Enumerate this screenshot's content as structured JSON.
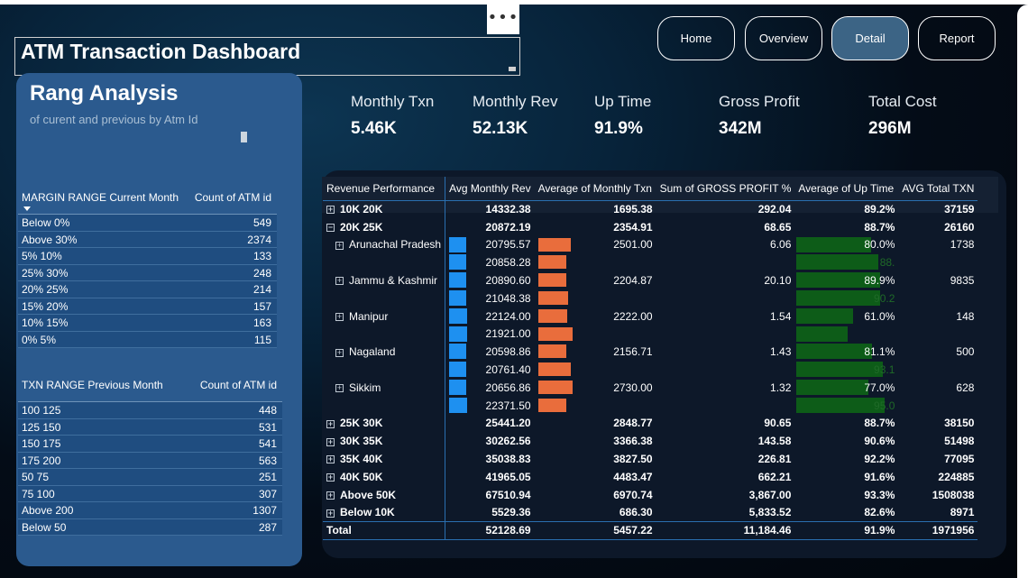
{
  "window": {
    "more_menu": "•••"
  },
  "header": {
    "title": "ATM Transaction Dashboard"
  },
  "nav": [
    {
      "label": "Home",
      "active": false
    },
    {
      "label": "Overview",
      "active": false
    },
    {
      "label": "Detail",
      "active": true
    },
    {
      "label": "Report",
      "active": false
    }
  ],
  "left": {
    "title": "Rang Analysis",
    "subtitle": "of curent and previous by Atm Id",
    "margin_table": {
      "col1": "MARGIN RANGE Current Month",
      "col2": "Count of ATM id",
      "rows": [
        [
          "Below 0%",
          "549"
        ],
        [
          "Above 30%",
          "2374"
        ],
        [
          "5% 10%",
          "133"
        ],
        [
          "25% 30%",
          "248"
        ],
        [
          "20% 25%",
          "214"
        ],
        [
          "15% 20%",
          "157"
        ],
        [
          "10% 15%",
          "163"
        ],
        [
          "0% 5%",
          "115"
        ]
      ]
    },
    "txn_table": {
      "col1": "TXN RANGE Previous Month",
      "col2": "Count of ATM id",
      "rows": [
        [
          "100  125",
          "448"
        ],
        [
          "125  150",
          "531"
        ],
        [
          "150  175",
          "541"
        ],
        [
          "175  200",
          "563"
        ],
        [
          "50  75",
          "251"
        ],
        [
          "75  100",
          "307"
        ],
        [
          "Above 200",
          "1307"
        ],
        [
          "Below 50",
          "287"
        ]
      ]
    }
  },
  "kpis": [
    {
      "label": "Monthly Txn",
      "value": "5.46K"
    },
    {
      "label": "Monthly Rev",
      "value": "52.13K"
    },
    {
      "label": "Up Time",
      "value": "91.9%"
    },
    {
      "label": "Gross Profit",
      "value": "342M"
    },
    {
      "label": "Total Cost",
      "value": "296M"
    }
  ],
  "matrix": {
    "columns": [
      "Revenue Performance",
      "Avg Monthly Rev",
      "Average of Monthly Txn",
      "Sum of GROSS PROFIT %",
      "Average of Up Time",
      "AVG Total TXN"
    ],
    "rows": [
      {
        "label": "10K 20K",
        "exp": "+",
        "type": "top",
        "rev": "14332.38",
        "txn": "1695.38",
        "gp": "292.04",
        "up": "89.2%",
        "tot": "37159"
      },
      {
        "label": "20K 25K",
        "exp": "−",
        "type": "top",
        "rev": "20872.19",
        "txn": "2354.91",
        "gp": "68.65",
        "up": "88.7%",
        "tot": "26160"
      },
      {
        "label": "Arunachal Pradesh",
        "exp": "+",
        "type": "sub",
        "rev": "20795.57",
        "txn": "2501.00",
        "gp": "6.06",
        "up": "80.0%",
        "tot": "1738",
        "rev_frac": 0.93,
        "txn_frac": 0.95,
        "up_frac": 0.8
      },
      {
        "label": "",
        "exp": "",
        "type": "sub",
        "rev": "20858.28",
        "txn": "",
        "gp": "",
        "up": "88.",
        "tot": "",
        "rev_frac": 0.93,
        "txn_frac": 0.82,
        "up_frac": 0.88,
        "ghost": true
      },
      {
        "label": "Jammu & Kashmir",
        "exp": "+",
        "type": "sub",
        "rev": "20890.60",
        "txn": "2204.87",
        "gp": "20.10",
        "up": "89.9%",
        "tot": "9835",
        "rev_frac": 0.94,
        "txn_frac": 0.84,
        "up_frac": 0.9
      },
      {
        "label": "",
        "exp": "",
        "type": "sub",
        "rev": "21048.38",
        "txn": "",
        "gp": "",
        "up": "90.2",
        "tot": "",
        "rev_frac": 0.95,
        "txn_frac": 0.88,
        "up_frac": 0.9,
        "ghost": true
      },
      {
        "label": "Manipur",
        "exp": "+",
        "type": "sub",
        "rev": "22124.00",
        "txn": "2222.00",
        "gp": "1.54",
        "up": "61.0%",
        "tot": "148",
        "rev_frac": 1.0,
        "txn_frac": 0.85,
        "up_frac": 0.61
      },
      {
        "label": "",
        "exp": "",
        "type": "sub",
        "rev": "21921.00",
        "txn": "",
        "gp": "",
        "up": "",
        "tot": "",
        "rev_frac": 0.99,
        "txn_frac": 1.0,
        "up_frac": 0.55,
        "ghost": true
      },
      {
        "label": "Nagaland",
        "exp": "+",
        "type": "sub",
        "rev": "20598.86",
        "txn": "2156.71",
        "gp": "1.43",
        "up": "81.1%",
        "tot": "500",
        "rev_frac": 0.93,
        "txn_frac": 0.82,
        "up_frac": 0.81
      },
      {
        "label": "",
        "exp": "",
        "type": "sub",
        "rev": "20761.40",
        "txn": "",
        "gp": "",
        "up": "93.1",
        "tot": "",
        "rev_frac": 0.94,
        "txn_frac": 0.96,
        "up_frac": 0.93,
        "ghost": true
      },
      {
        "label": "Sikkim",
        "exp": "+",
        "type": "sub",
        "rev": "20656.86",
        "txn": "2730.00",
        "gp": "1.32",
        "up": "77.0%",
        "tot": "628",
        "rev_frac": 0.93,
        "txn_frac": 1.0,
        "up_frac": 0.77
      },
      {
        "label": "",
        "exp": "",
        "type": "sub",
        "rev": "22371.50",
        "txn": "",
        "gp": "",
        "up": "95.0",
        "tot": "",
        "rev_frac": 1.0,
        "txn_frac": 0.82,
        "up_frac": 0.95,
        "ghost": true
      },
      {
        "label": "25K 30K",
        "exp": "+",
        "type": "top",
        "rev": "25441.20",
        "txn": "2848.77",
        "gp": "90.65",
        "up": "88.7%",
        "tot": "38150"
      },
      {
        "label": "30K 35K",
        "exp": "+",
        "type": "top",
        "rev": "30262.56",
        "txn": "3366.38",
        "gp": "143.58",
        "up": "90.6%",
        "tot": "51498"
      },
      {
        "label": "35K 40K",
        "exp": "+",
        "type": "top",
        "rev": "35038.83",
        "txn": "3827.50",
        "gp": "226.81",
        "up": "92.2%",
        "tot": "77095"
      },
      {
        "label": "40K 50K",
        "exp": "+",
        "type": "top",
        "rev": "41965.05",
        "txn": "4483.47",
        "gp": "662.21",
        "up": "91.6%",
        "tot": "224885"
      },
      {
        "label": "Above 50K",
        "exp": "+",
        "type": "top",
        "rev": "67510.94",
        "txn": "6970.74",
        "gp": "3,867.00",
        "up": "93.3%",
        "tot": "1508038"
      },
      {
        "label": "Below 10K",
        "exp": "+",
        "type": "top",
        "rev": "5529.36",
        "txn": "686.30",
        "gp": "5,833.52",
        "up": "82.6%",
        "tot": "8971"
      },
      {
        "label": "Total",
        "exp": "",
        "type": "total",
        "rev": "52128.69",
        "txn": "5457.22",
        "gp": "11,184.46",
        "up": "91.9%",
        "tot": "1971956"
      }
    ]
  },
  "colors": {
    "rev_bar": "#1e90f0",
    "txn_bar": "#e96d3c",
    "up_bar": "#0d5c18"
  }
}
